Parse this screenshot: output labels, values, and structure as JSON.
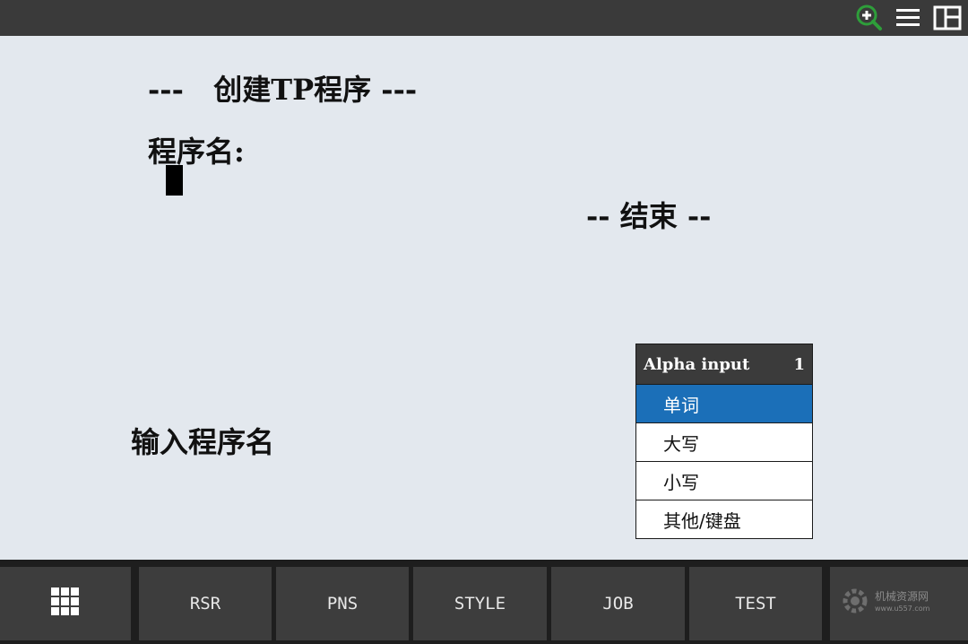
{
  "topbar": {
    "icons": [
      "zoom-in-icon",
      "menu-icon",
      "layout-split-icon"
    ]
  },
  "screen": {
    "title": "---   创建TP程序 ---",
    "program_name_label": "程序名:",
    "end_label": "-- 结束 --",
    "prompt": "输入程序名"
  },
  "alpha_menu": {
    "header": "Alpha input",
    "page": "1",
    "items": [
      "单词",
      "大写",
      "小写",
      "其他/键盘"
    ],
    "selected_index": 0
  },
  "function_keys": {
    "grid_icon": "grid-icon",
    "keys": [
      "RSR",
      "PNS",
      "STYLE",
      "JOB",
      "TEST"
    ]
  },
  "watermark": {
    "name": "机械资源网",
    "url": "www.u557.com"
  },
  "colors": {
    "screen_bg": "#e3e8ee",
    "selected": "#1b6fb8",
    "zoom_icon": "#2e9e3a"
  }
}
